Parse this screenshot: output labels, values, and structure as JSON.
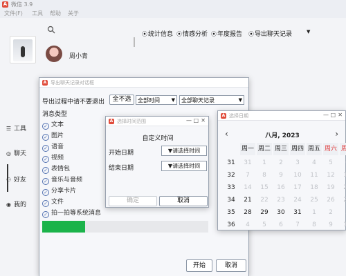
{
  "main": {
    "app_title": "微信 3.9",
    "menu": [
      "文件(F)",
      "工具",
      "帮助",
      "关于"
    ],
    "contact_name": "周小青",
    "toolbar": [
      {
        "icon": "chart-icon",
        "label": "统计信息"
      },
      {
        "icon": "chart-icon",
        "label": "情感分析"
      },
      {
        "icon": "chart-icon",
        "label": "年度报告"
      },
      {
        "icon": "chart-icon",
        "label": "导出聊天记录"
      }
    ],
    "sidebar": [
      {
        "icon": "tool-icon",
        "label": "工具"
      },
      {
        "icon": "chat-icon",
        "label": "聊天"
      },
      {
        "icon": "friends-icon",
        "label": "好友"
      },
      {
        "icon": "me-icon",
        "label": "我的"
      }
    ]
  },
  "export_dialog": {
    "title": "导出聊天记录对话框",
    "controls": [
      "—",
      "□",
      "✕"
    ],
    "export_label": "导出过程中请不要退出",
    "select_all_label": "全不选",
    "time_select_value": "全部时间",
    "record_select_value": "全部聊天记录",
    "msg_type_label": "消息类型",
    "message_types": [
      "文本",
      "图片",
      "语音",
      "视频",
      "表情包",
      "音乐与音频",
      "分享卡片",
      "文件",
      "拍一拍等系统消息"
    ],
    "progress": 0.26,
    "start_label": "开始",
    "cancel_label": "取消"
  },
  "time_dialog": {
    "title": "选择时间范围",
    "controls": [
      "—",
      "□",
      "✕"
    ],
    "heading": "自定义时间",
    "start_label": "开始日期",
    "end_label": "结束日期",
    "pick_label": "▼请选择时间",
    "ok_label": "确定",
    "cancel_label": "取消"
  },
  "calendar_dialog": {
    "title": "选择日期",
    "controls": [
      "—",
      "□",
      "✕"
    ],
    "month_label": "八月,  2023",
    "prev": "‹",
    "next": "›",
    "weekdays": [
      "周一",
      "周二",
      "周三",
      "周四",
      "周五",
      "周六",
      "周日"
    ],
    "weeks": [
      {
        "wk": "31",
        "days": [
          "31",
          "1",
          "2",
          "3",
          "4",
          "5",
          "6"
        ],
        "dim": [
          true,
          true,
          true,
          true,
          true,
          true,
          true
        ]
      },
      {
        "wk": "32",
        "days": [
          "7",
          "8",
          "9",
          "10",
          "11",
          "12",
          "13"
        ],
        "dim": [
          true,
          true,
          true,
          true,
          true,
          true,
          true
        ]
      },
      {
        "wk": "33",
        "days": [
          "14",
          "15",
          "16",
          "17",
          "18",
          "19",
          "20"
        ],
        "dim": [
          true,
          true,
          true,
          true,
          true,
          true,
          true
        ]
      },
      {
        "wk": "34",
        "days": [
          "21",
          "22",
          "23",
          "24",
          "25",
          "26",
          "27"
        ],
        "dim": [
          false,
          true,
          true,
          true,
          true,
          true,
          true
        ]
      },
      {
        "wk": "35",
        "days": [
          "28",
          "29",
          "30",
          "31",
          "1",
          "2",
          "3"
        ],
        "dim": [
          false,
          false,
          false,
          false,
          true,
          true,
          true
        ]
      },
      {
        "wk": "36",
        "days": [
          "4",
          "5",
          "6",
          "7",
          "8",
          "9",
          "10"
        ],
        "dim": [
          true,
          true,
          true,
          true,
          true,
          true,
          true
        ]
      }
    ]
  }
}
